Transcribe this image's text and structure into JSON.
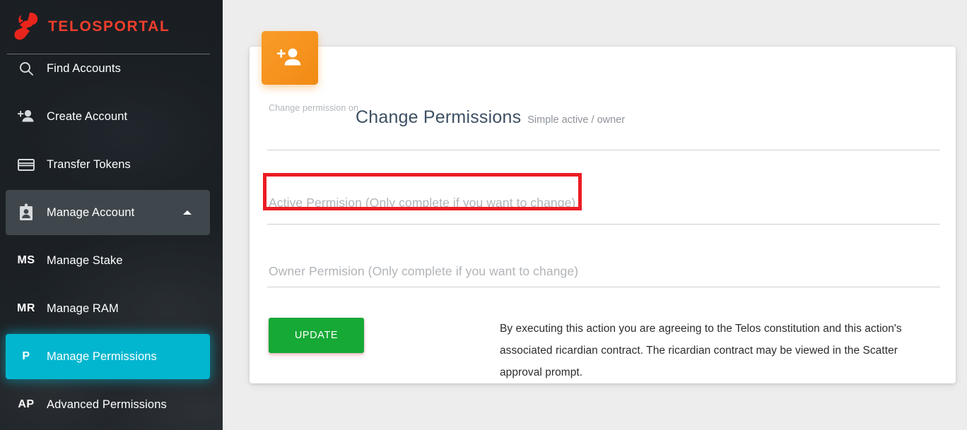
{
  "brand": {
    "name": "TELOSPORTAL",
    "logo_icon": "telos-logo-icon",
    "accent_color": "#ef3e2c"
  },
  "sidebar": {
    "items": [
      {
        "label": "Find Accounts",
        "icon": "search-icon",
        "icon_text": "",
        "state": "normal"
      },
      {
        "label": "Create Account",
        "icon": "person-add-icon",
        "icon_text": "",
        "state": "normal"
      },
      {
        "label": "Transfer Tokens",
        "icon": "credit-card-icon",
        "icon_text": "",
        "state": "normal"
      },
      {
        "label": "Manage Account",
        "icon": "id-badge-icon",
        "icon_text": "",
        "state": "expanded"
      },
      {
        "label": "Manage Stake",
        "icon": "",
        "icon_text": "MS",
        "state": "normal"
      },
      {
        "label": "Manage RAM",
        "icon": "",
        "icon_text": "MR",
        "state": "normal"
      },
      {
        "label": "Manage Permissions",
        "icon": "",
        "icon_text": "P",
        "state": "active"
      },
      {
        "label": "Advanced Permissions",
        "icon": "",
        "icon_text": "AP",
        "state": "normal"
      }
    ],
    "active_color": "#01b6ce",
    "expanded_color": "#3f474c"
  },
  "card": {
    "icon": "person-add-icon",
    "icon_color": "#f79420",
    "title": "Change Permissions",
    "subtitle": "Simple active / owner",
    "fields": {
      "account": {
        "label": "Change permission on",
        "value": ""
      },
      "active_permission": {
        "placeholder": "Active Permision (Only complete if you want to change)",
        "value": "",
        "highlighted": true,
        "highlight_color": "#ec1c24"
      },
      "owner_permission": {
        "placeholder": "Owner Permision (Only complete if you want to change)",
        "value": "",
        "highlighted": false
      }
    },
    "update_button": {
      "label": "UPDATE",
      "color": "#16a936"
    },
    "legal_text": "By executing this action you are agreeing to the Telos constitution and this action's associated ricardian contract. The ricardian contract may be viewed in the Scatter approval prompt."
  }
}
